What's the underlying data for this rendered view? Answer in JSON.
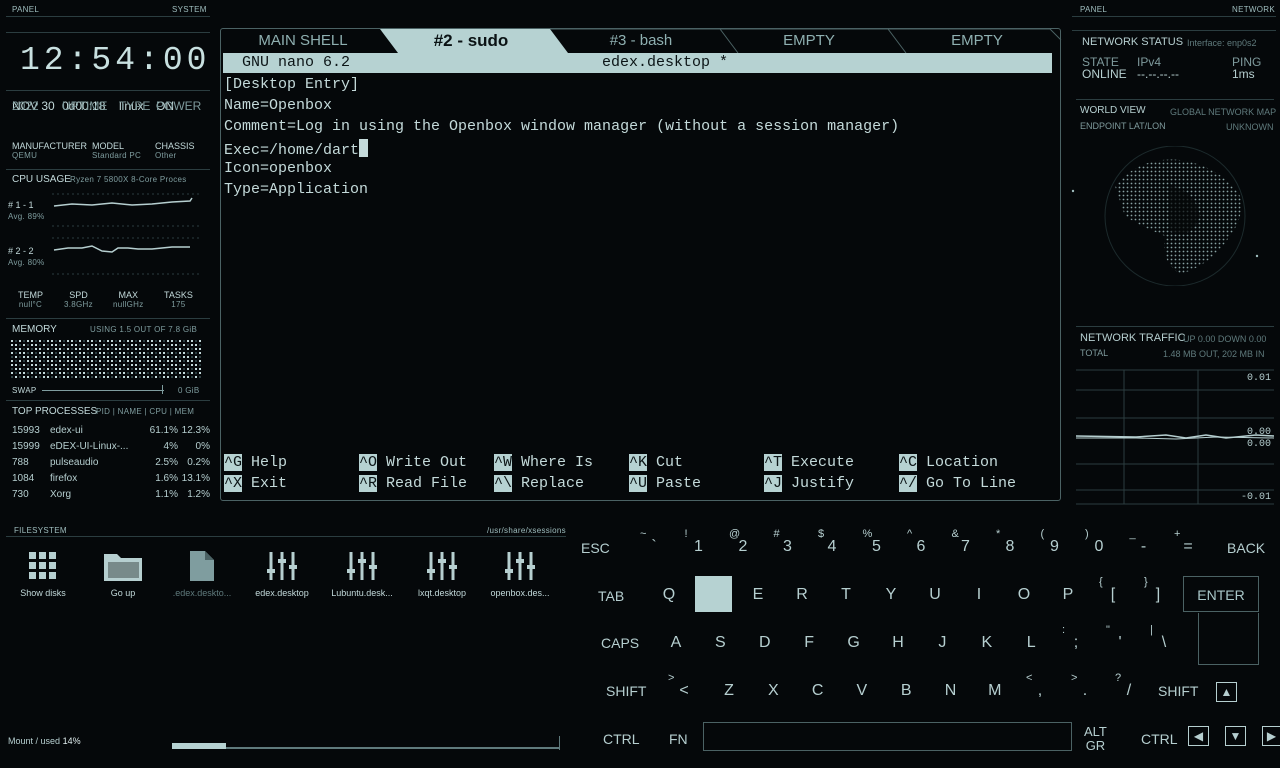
{
  "left_panel": {
    "panel_label": "PANEL",
    "system_label": "SYSTEM",
    "clock": "12:54:00",
    "stats": {
      "year": "2022",
      "date": "NOV 30",
      "uptime_label": "UPTIME",
      "uptime": "0d00:18",
      "type_label": "TYPE",
      "type": "linux",
      "power_label": "POWER",
      "power": "ON"
    },
    "hw": {
      "manufacturer_label": "MANUFACTURER",
      "manufacturer": "QEMU",
      "model_label": "MODEL",
      "model": "Standard PC",
      "chassis_label": "CHASSIS",
      "chassis": "Other"
    },
    "cpu": {
      "title": "CPU USAGE",
      "model": "Ryzen 7 5800X 8-Core Proces",
      "core1_label": "# 1 - 1",
      "core1_avg": "Avg. 89%",
      "core2_label": "# 2 - 2",
      "core2_avg": "Avg. 80%",
      "temp_label": "TEMP",
      "temp": "null°C",
      "spd_label": "SPD",
      "spd": "3.8GHz",
      "max_label": "MAX",
      "max": "nullGHz",
      "tasks_label": "TASKS",
      "tasks": "175"
    },
    "memory": {
      "title": "MEMORY",
      "usage": "USING 1.5 OUT OF 7.8 GiB",
      "swap_label": "SWAP",
      "swap_value": "0 GiB"
    },
    "processes": {
      "title": "TOP PROCESSES",
      "columns": "PID | NAME | CPU | MEM",
      "rows": [
        {
          "pid": "15993",
          "name": "edex-ui",
          "cpu": "61.1%",
          "mem": "12.3%"
        },
        {
          "pid": "15999",
          "name": "eDEX-UI-Linux-...",
          "cpu": "4%",
          "mem": "0%"
        },
        {
          "pid": "788",
          "name": "pulseaudio",
          "cpu": "2.5%",
          "mem": "0.2%"
        },
        {
          "pid": "1084",
          "name": "firefox",
          "cpu": "1.6%",
          "mem": "13.1%"
        },
        {
          "pid": "730",
          "name": "Xorg",
          "cpu": "1.1%",
          "mem": "1.2%"
        }
      ]
    }
  },
  "terminal": {
    "tabs": [
      {
        "label": "MAIN SHELL"
      },
      {
        "label": "#2 - sudo"
      },
      {
        "label": "#3 - bash"
      },
      {
        "label": "EMPTY"
      },
      {
        "label": "EMPTY"
      }
    ],
    "nano_version": "GNU nano 6.2",
    "file_name": "edex.desktop *",
    "lines": [
      "[Desktop Entry]",
      "Name=Openbox",
      "Comment=Log in using the Openbox window manager (without a session manager)",
      "Exec=/home/dart",
      "Icon=openbox",
      "Type=Application"
    ],
    "shortcuts": [
      {
        "key": "^G",
        "label": "Help"
      },
      {
        "key": "^O",
        "label": "Write Out"
      },
      {
        "key": "^W",
        "label": "Where Is"
      },
      {
        "key": "^K",
        "label": "Cut"
      },
      {
        "key": "^T",
        "label": "Execute"
      },
      {
        "key": "^C",
        "label": "Location"
      },
      {
        "key": "^X",
        "label": "Exit"
      },
      {
        "key": "^R",
        "label": "Read File"
      },
      {
        "key": "^\\",
        "label": "Replace"
      },
      {
        "key": "^U",
        "label": "Paste"
      },
      {
        "key": "^J",
        "label": "Justify"
      },
      {
        "key": "^/",
        "label": "Go To Line"
      }
    ]
  },
  "right_panel": {
    "panel_label": "PANEL",
    "network_label": "NETWORK",
    "status_title": "NETWORK STATUS",
    "interface": "Interface: enp0s2",
    "state_label": "STATE",
    "state": "ONLINE",
    "ipv4_label": "IPv4",
    "ipv4": "--.--.--.--",
    "ping_label": "PING",
    "ping": "1ms",
    "world_title": "WORLD VIEW",
    "world_sub": "GLOBAL NETWORK MAP",
    "endpoint_label": "ENDPOINT LAT/LON",
    "endpoint_value": "UNKNOWN",
    "traffic_title": "NETWORK TRAFFIC",
    "traffic_rates": "UP 0.00 DOWN 0.00",
    "total_label": "TOTAL",
    "total_value": "1.48 MB OUT, 202 MB IN",
    "chart_ticks": [
      "0.01",
      "0.00",
      "0.00",
      "-0.01"
    ]
  },
  "filesystem": {
    "title": "FILESYSTEM",
    "path": "/usr/share/xsessions",
    "items": [
      {
        "label": "Show disks",
        "icon": "grid-icon"
      },
      {
        "label": "Go up",
        "icon": "folder-icon"
      },
      {
        "label": ".edex.deskto...",
        "icon": "file-icon"
      },
      {
        "label": "edex.desktop",
        "icon": "settings-icon"
      },
      {
        "label": "Lubuntu.desk...",
        "icon": "settings-icon"
      },
      {
        "label": "lxqt.desktop",
        "icon": "settings-icon"
      },
      {
        "label": "openbox.des...",
        "icon": "settings-icon"
      }
    ],
    "mount_label": "Mount",
    "used_label": "used",
    "used_value": "14%",
    "used_fraction": 0.14
  },
  "keyboard": {
    "esc": "ESC",
    "back": "BACK",
    "tab": "TAB",
    "enter": "ENTER",
    "caps": "CAPS",
    "shift_l": "SHIFT",
    "shift_r": "SHIFT",
    "ctrl_l": "CTRL",
    "fn": "FN",
    "alt": "ALT",
    "gr": "GR",
    "ctrl_r": "CTRL",
    "row1": [
      {
        "main": "`",
        "sup": "~"
      },
      {
        "main": "1",
        "sup": "!"
      },
      {
        "main": "2",
        "sup": "@"
      },
      {
        "main": "3",
        "sup": "#"
      },
      {
        "main": "4",
        "sup": "$"
      },
      {
        "main": "5",
        "sup": "%"
      },
      {
        "main": "6",
        "sup": "^"
      },
      {
        "main": "7",
        "sup": "&"
      },
      {
        "main": "8",
        "sup": "*"
      },
      {
        "main": "9",
        "sup": "("
      },
      {
        "main": "0",
        "sup": ")"
      },
      {
        "main": "-",
        "sup": "_"
      },
      {
        "main": "=",
        "sup": "+"
      }
    ],
    "row2": [
      "Q",
      "",
      "E",
      "R",
      "T",
      "Y",
      "U",
      "I",
      "O",
      "P"
    ],
    "row2_brackets": [
      {
        "main": "[",
        "sup": "{"
      },
      {
        "main": "]",
        "sup": "}"
      }
    ],
    "row3": [
      "A",
      "S",
      "D",
      "F",
      "G",
      "H",
      "J",
      "K",
      "L"
    ],
    "row3_extra": [
      {
        "main": ";",
        "sup": ":"
      },
      {
        "main": "'",
        "sup": "\""
      },
      {
        "main": "\\",
        "sup": "|"
      }
    ],
    "row4": [
      "Z",
      "X",
      "C",
      "V",
      "B",
      "N",
      "M"
    ],
    "row4_extra": [
      {
        "main": ",",
        "sup": "<"
      },
      {
        "main": ".",
        "sup": ">"
      },
      {
        "main": "/",
        "sup": "?"
      }
    ],
    "row4_first": {
      "main": "<",
      "sup": ">"
    }
  }
}
